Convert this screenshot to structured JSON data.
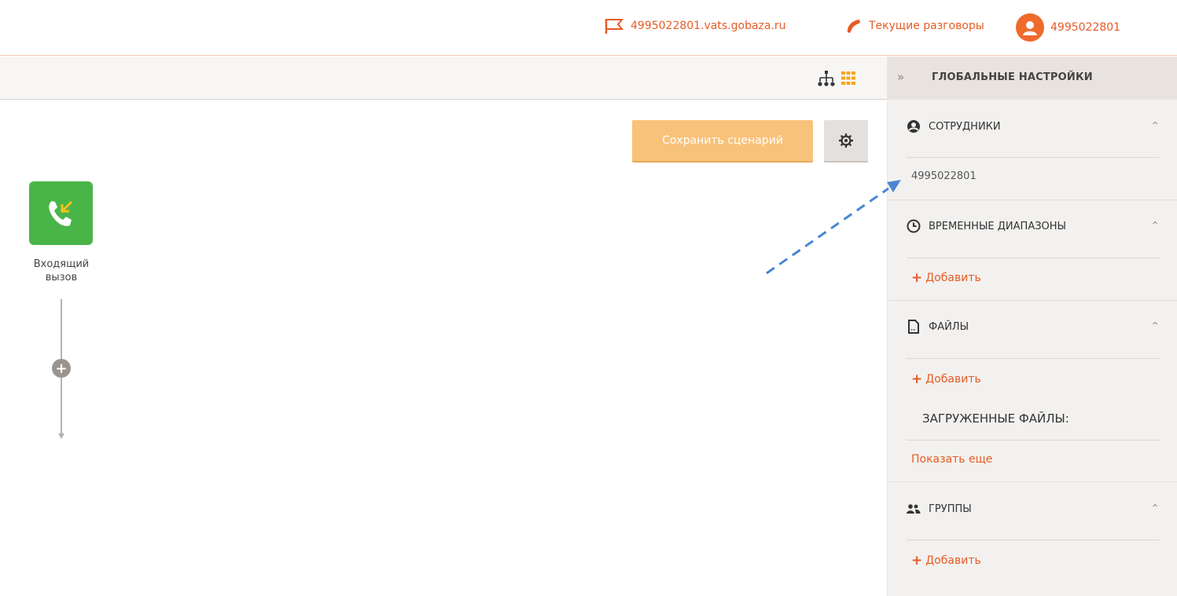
{
  "header": {
    "domain": "4995022801.vats.gobaza.ru",
    "current_calls": "Текущие разговоры",
    "user": "4995022801"
  },
  "toolbar": {
    "view_icons": [
      "tree-icon",
      "grid-icon"
    ]
  },
  "canvas": {
    "save_button": "Сохранить сценарий",
    "node": {
      "label_line1": "Входящий",
      "label_line2": "вызов"
    }
  },
  "sidebar": {
    "title": "ГЛОБАЛЬНЫЕ НАСТРОЙКИ",
    "employees": {
      "title": "СОТРУДНИКИ",
      "items": [
        "4995022801"
      ]
    },
    "time_ranges": {
      "title": "ВРЕМЕННЫЕ ДИАПАЗОНЫ",
      "add": "Добавить"
    },
    "files": {
      "title": "ФАЙЛЫ",
      "add": "Добавить",
      "uploaded_label": "ЗАГРУЖЕННЫЕ ФАЙЛЫ:",
      "show_more": "Показать еще"
    },
    "groups": {
      "title": "ГРУППЫ",
      "add": "Добавить"
    }
  },
  "colors": {
    "accent": "#e65b25",
    "node_green": "#49b548",
    "save_button": "#f9c27a",
    "annotation_arrow": "#4a86d4"
  }
}
